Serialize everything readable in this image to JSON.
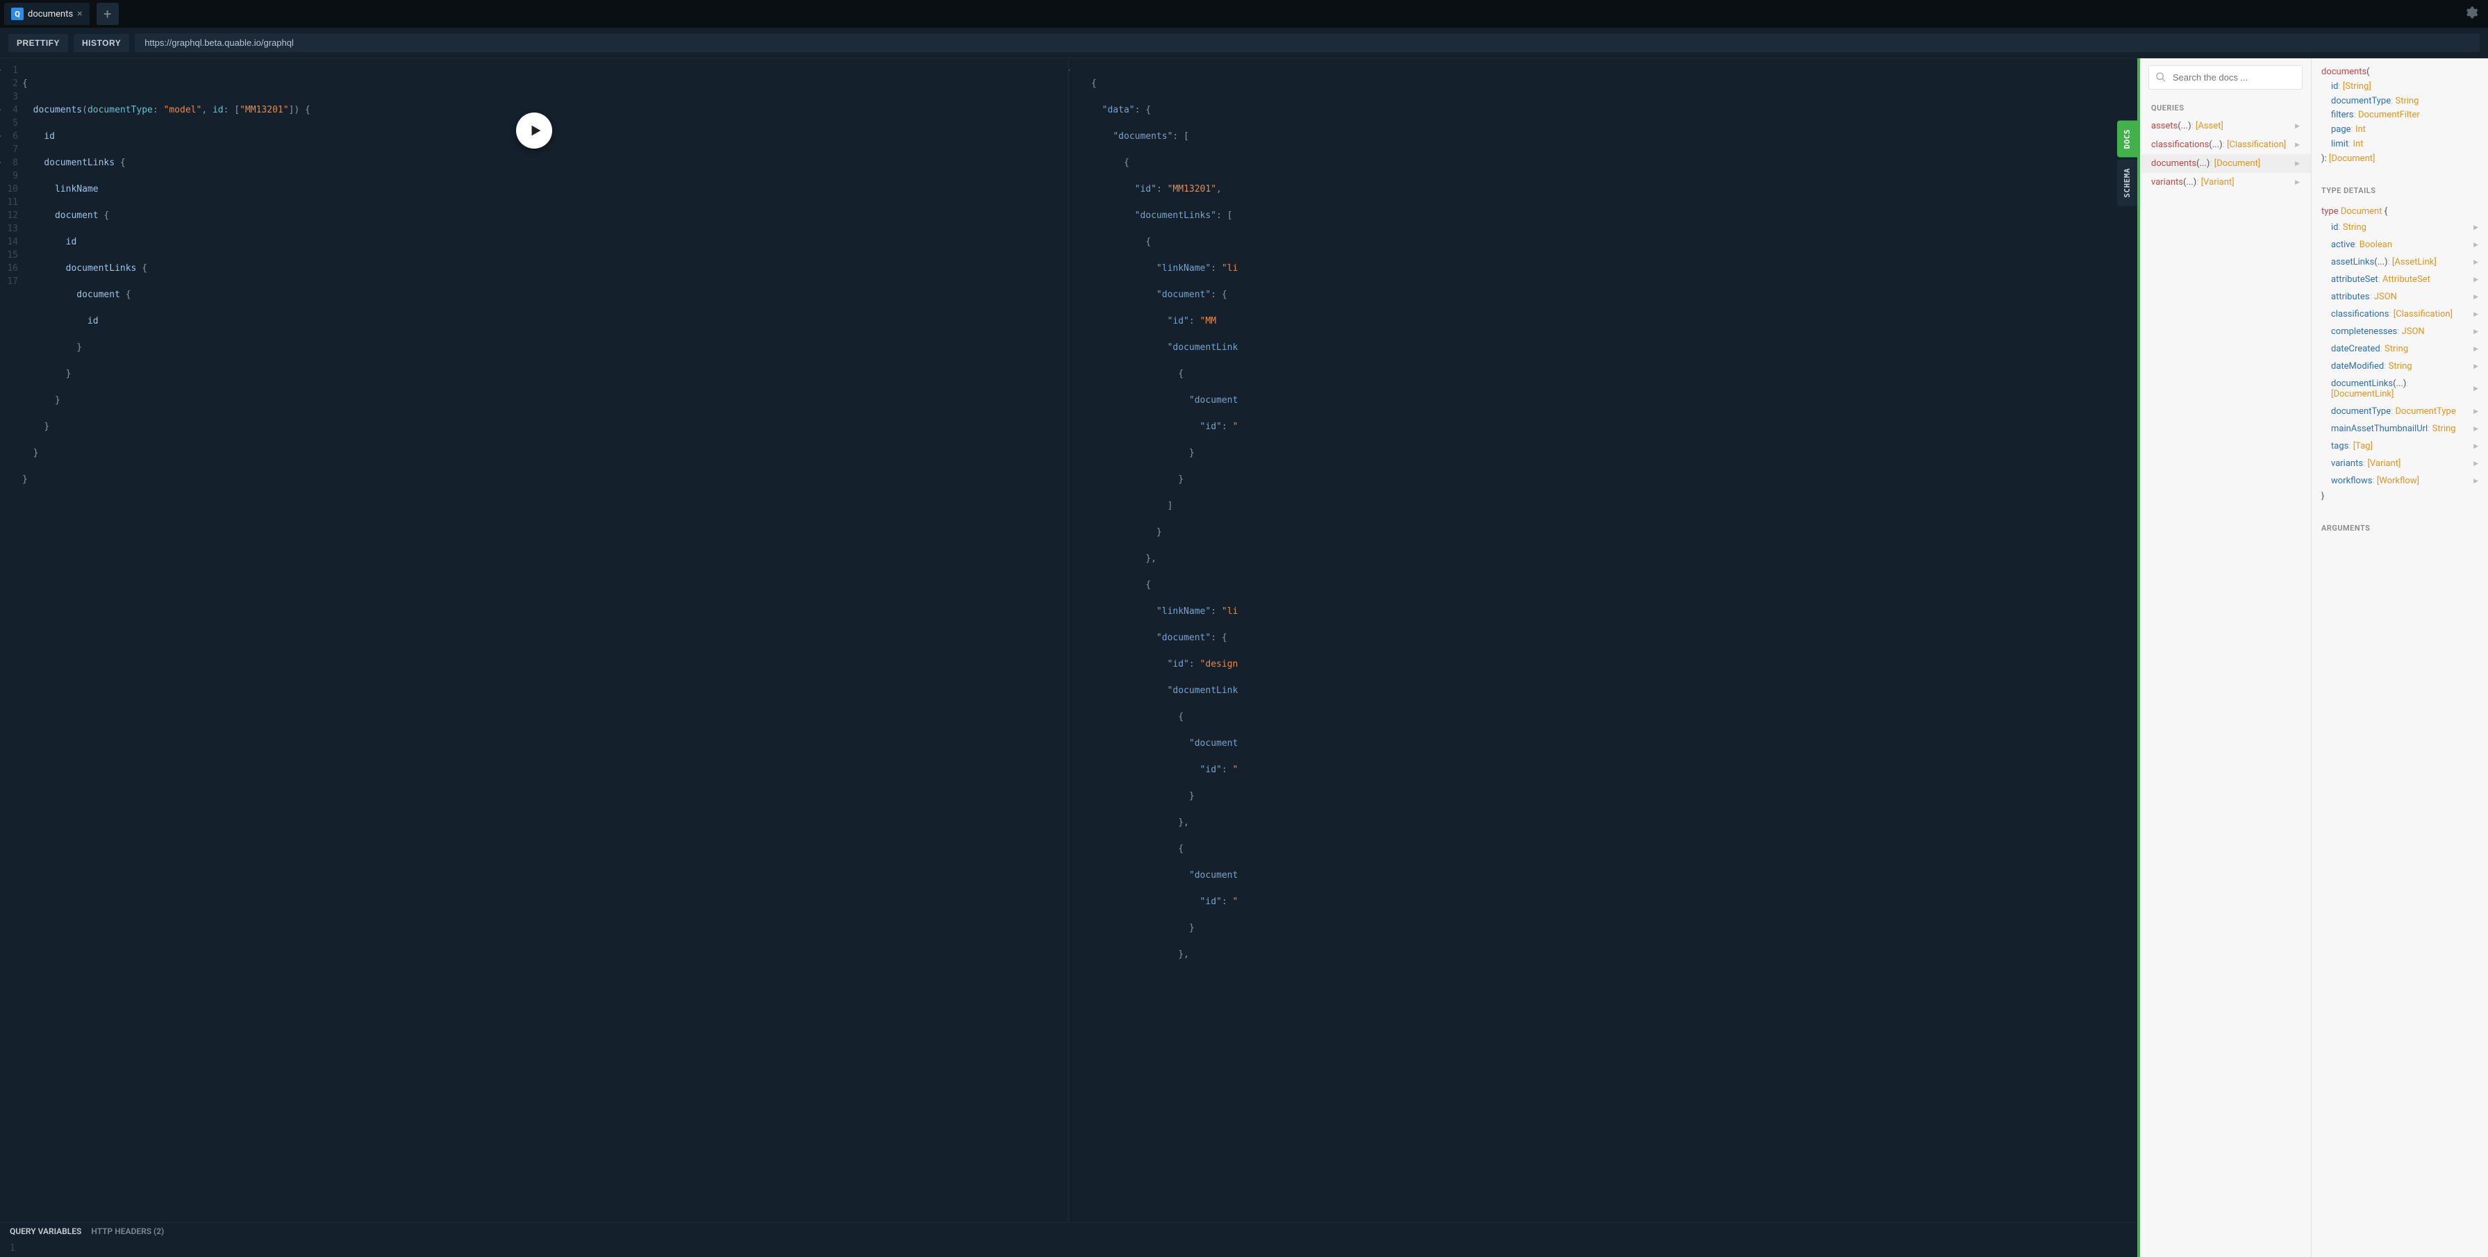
{
  "tabs": {
    "current": "documents",
    "q_badge": "Q"
  },
  "toolbar": {
    "prettify": "PRETTIFY",
    "history": "HISTORY",
    "endpoint": "https://graphql.beta.quable.io/graphql"
  },
  "side_tabs": {
    "docs": "DOCS",
    "schema": "SCHEMA"
  },
  "footer": {
    "query_variables": "QUERY VARIABLES",
    "http_headers": "HTTP HEADERS (2)",
    "var_line": "1"
  },
  "query": {
    "line1_brace": "{",
    "line2": {
      "field": "documents",
      "p1": "(",
      "arg1": "documentType",
      "c1": ":",
      "s1": " ",
      "v1": "\"model\"",
      "comma": ", ",
      "arg2": "id",
      "c2": ":",
      "s2": " ",
      "lb": "[",
      "v2": "\"MM13201\"",
      "rb": "]",
      "p2": ")",
      "s3": " ",
      "ob": "{"
    },
    "line3_id": "id",
    "line4": {
      "field": "documentLinks",
      "ob": " {"
    },
    "line5_linkName": "linkName",
    "line6": {
      "field": "document",
      "ob": " {"
    },
    "line7_id": "id",
    "line8": {
      "field": "documentLinks",
      "ob": " {"
    },
    "line9": {
      "field": "document",
      "ob": " {"
    },
    "line10_id": "id",
    "close10": "}",
    "close9": "}",
    "close8": "}",
    "close6": "}",
    "close4": "}",
    "close1": "}"
  },
  "result": {
    "l1": "{",
    "l2_k": "\"data\"",
    "l2_c": ": {",
    "l3_k": "\"documents\"",
    "l3_c": ": [",
    "l4": "{",
    "l5_k": "\"id\"",
    "l5_c": ": ",
    "l5_v": "\"MM13201\"",
    "l5_e": ",",
    "l6_k": "\"documentLinks\"",
    "l6_c": ": [",
    "l7": "{",
    "l8_k": "\"linkName\"",
    "l8_c": ": ",
    "l8_v": "\"li",
    "l9_k": "\"document\"",
    "l9_c": ": {",
    "l10_k": "\"id\"",
    "l10_c": ": ",
    "l10_v": "\"MM",
    "l11_k": "\"documentLink",
    "l12": "{",
    "l13_k": "\"document",
    "l14_k": "\"id\"",
    "l14_c": ": ",
    "l14_v": "\"",
    "l15": "}",
    "l16": "}",
    "l17": "]",
    "l18": "}",
    "l19": "},",
    "l20": "{",
    "l21_k": "\"linkName\"",
    "l21_c": ": ",
    "l21_v": "\"li",
    "l22_k": "\"document\"",
    "l22_c": ": {",
    "l23_k": "\"id\"",
    "l23_c": ": ",
    "l23_v": "\"design",
    "l24_k": "\"documentLink",
    "l25": "{",
    "l26_k": "\"document",
    "l27_k": "\"id\"",
    "l27_c": ": ",
    "l27_v": "\"",
    "l28": "}",
    "l29": "},",
    "l30": "{",
    "l31_k": "\"document",
    "l32_k": "\"id\"",
    "l32_c": ": ",
    "l32_v": "\"",
    "l33": "}",
    "l34": "},"
  },
  "docs": {
    "search_placeholder": "Search the docs ...",
    "section_queries": "QUERIES",
    "queries": [
      {
        "name": "assets",
        "args": "(...)",
        "sep": ": ",
        "type": "[Asset]"
      },
      {
        "name": "classifications",
        "args": "(...)",
        "sep": ": ",
        "type": "[Classification]"
      },
      {
        "name": "documents",
        "args": "(...)",
        "sep": ": ",
        "type": "[Document]"
      },
      {
        "name": "variants",
        "args": "(...)",
        "sep": ": ",
        "type": "[Variant]"
      }
    ],
    "signature": {
      "name": "documents",
      "open": "(",
      "args": [
        {
          "name": "id",
          "sep": ": ",
          "type": "[String]"
        },
        {
          "name": "documentType",
          "sep": ": ",
          "type": "String"
        },
        {
          "name": "filters",
          "sep": ": ",
          "type": "DocumentFilter"
        },
        {
          "name": "page",
          "sep": ": ",
          "type": "Int"
        },
        {
          "name": "limit",
          "sep": ": ",
          "type": "Int"
        }
      ],
      "close": "): ",
      "rtype": "[Document]"
    },
    "section_type_details": "TYPE DETAILS",
    "type_kw": "type ",
    "type_name": "Document",
    "type_open": " {",
    "fields": [
      {
        "name": "id",
        "sep": ": ",
        "type": "String"
      },
      {
        "name": "active",
        "sep": ": ",
        "type": "Boolean"
      },
      {
        "name": "assetLinks",
        "args": "(...)",
        "sep": ": ",
        "type": "[AssetLink]"
      },
      {
        "name": "attributeSet",
        "sep": ": ",
        "type": "AttributeSet"
      },
      {
        "name": "attributes",
        "sep": ": ",
        "type": "JSON"
      },
      {
        "name": "classifications",
        "sep": ": ",
        "type": "[Classification]"
      },
      {
        "name": "completenesses",
        "sep": ": ",
        "type": "JSON"
      },
      {
        "name": "dateCreated",
        "sep": ": ",
        "type": "String"
      },
      {
        "name": "dateModified",
        "sep": ": ",
        "type": "String"
      },
      {
        "name": "documentLinks",
        "args": "(...)",
        "sep": ": ",
        "type": "[DocumentLink]"
      },
      {
        "name": "documentType",
        "sep": ": ",
        "type": "DocumentType"
      },
      {
        "name": "mainAssetThumbnailUrl",
        "sep": ": ",
        "type": "String"
      },
      {
        "name": "tags",
        "sep": ": ",
        "type": "[Tag]"
      },
      {
        "name": "variants",
        "sep": ": ",
        "type": "[Variant]"
      },
      {
        "name": "workflows",
        "sep": ": ",
        "type": "[Workflow]"
      }
    ],
    "type_close": "}",
    "section_arguments": "ARGUMENTS"
  }
}
